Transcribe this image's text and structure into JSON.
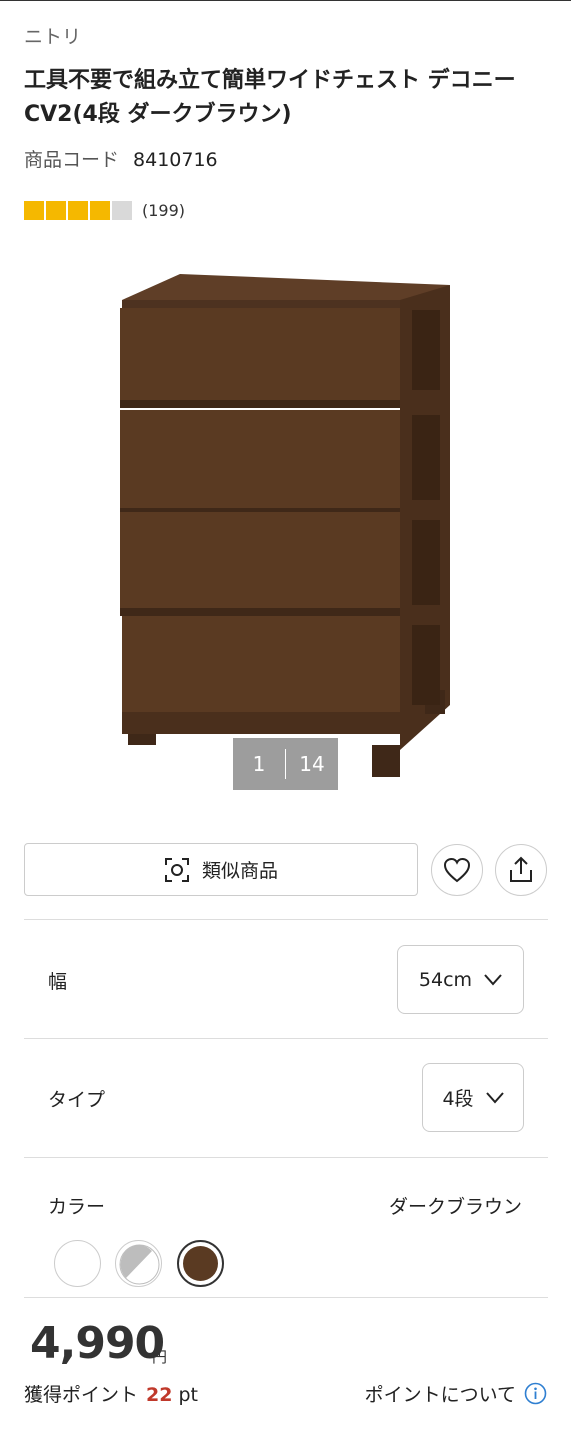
{
  "product": {
    "brand": "ニトリ",
    "title_line1": "工具不要で組み立て簡単ワイドチェスト デコニー",
    "title_line2": "CV2(4段 ダークブラウン)",
    "code_label": "商品コード",
    "code_value": "8410716",
    "rating_stars": 4,
    "rating_max": 5,
    "review_count": "(199)"
  },
  "gallery": {
    "current": "1",
    "total": "14",
    "image_alt": "chest-of-drawers-dark-brown"
  },
  "actions": {
    "similar_label": "類似商品",
    "favorite_icon": "heart-icon",
    "share_icon": "share-icon"
  },
  "options": {
    "width": {
      "label": "幅",
      "value": "54cm"
    },
    "type": {
      "label": "タイプ",
      "value": "4段"
    },
    "color": {
      "label": "カラー",
      "selected": "ダークブラウン",
      "swatches": [
        "#ffffff",
        "#bdbdbd",
        "#5a3a22"
      ]
    }
  },
  "pricing": {
    "price": "4,990",
    "currency": "円",
    "points_label": "獲得ポイント",
    "points_value": "22",
    "points_unit": "pt",
    "points_link": "ポイントについて"
  },
  "colors": {
    "star": "#f5b800",
    "points_accent": "#c0392b",
    "info_blue": "#2f7fd1",
    "furniture_brown": "#5a3a22"
  }
}
